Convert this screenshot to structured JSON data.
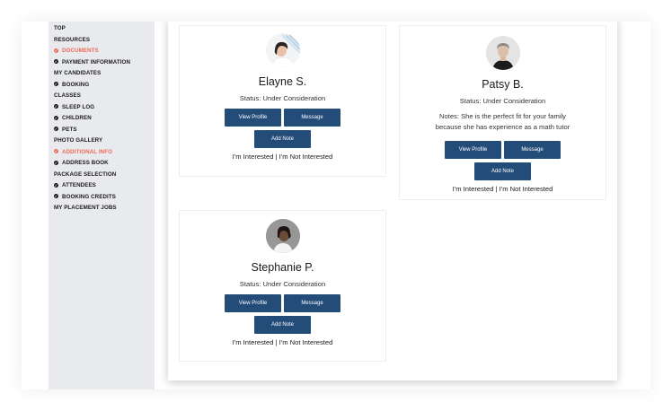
{
  "sidebar": {
    "items": [
      {
        "label": "TOP",
        "check": false,
        "active": false
      },
      {
        "label": "RESOURCES",
        "check": false,
        "active": false
      },
      {
        "label": "DOCUMENTS",
        "check": true,
        "active": true
      },
      {
        "label": "PAYMENT INFORMATION",
        "check": true,
        "active": false
      },
      {
        "label": "MY CANDIDATES",
        "check": false,
        "active": false
      },
      {
        "label": "BOOKING",
        "check": true,
        "active": false
      },
      {
        "label": "CLASSES",
        "check": false,
        "active": false
      },
      {
        "label": "SLEEP LOG",
        "check": true,
        "active": false
      },
      {
        "label": "CHILDREN",
        "check": true,
        "active": false
      },
      {
        "label": "PETS",
        "check": true,
        "active": false
      },
      {
        "label": "PHOTO GALLERY",
        "check": false,
        "active": false
      },
      {
        "label": "ADDITIONAL INFO",
        "check": true,
        "active": true
      },
      {
        "label": "ADDRESS BOOK",
        "check": true,
        "active": false
      },
      {
        "label": "PACKAGE SELECTION",
        "check": false,
        "active": false
      },
      {
        "label": "ATTENDEES",
        "check": true,
        "active": false
      },
      {
        "label": "BOOKING CREDITS",
        "check": true,
        "active": false
      },
      {
        "label": "MY PLACEMENT JOBS",
        "check": false,
        "active": false
      }
    ]
  },
  "candidates": [
    {
      "name": "Elayne S.",
      "status": "Status: Under Consideration",
      "view_profile": "View Profile",
      "message": "Message",
      "add_note": "Add Note",
      "interested": "I'm Interested",
      "separator": " | ",
      "not_interested": "I'm Not Interested"
    },
    {
      "name": "Patsy B.",
      "status": "Status: Under Consideration",
      "notes_line1": "Notes: She is the perfect fit for your family",
      "notes_line2": "because she has experience as a math tutor",
      "view_profile": "View Profile",
      "message": "Message",
      "add_note": "Add Note",
      "interested": "I'm Interested",
      "separator": " | ",
      "not_interested": "I'm Not Interested"
    },
    {
      "name": "Stephanie P.",
      "status": "Status: Under Consideration",
      "view_profile": "View Profile",
      "message": "Message",
      "add_note": "Add Note",
      "interested": "I'm Interested",
      "separator": " | ",
      "not_interested": "I'm Not Interested"
    }
  ],
  "colors": {
    "button": "#234c78",
    "active_nav": "#f06a5a",
    "sidebar_bg": "#e9eaed"
  }
}
